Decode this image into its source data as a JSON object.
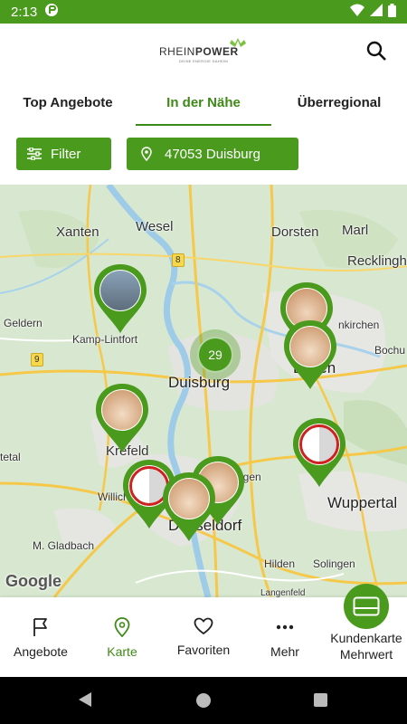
{
  "status_bar": {
    "time": "2:13"
  },
  "header": {
    "brand_light": "RHEIN",
    "brand_bold": "POWER",
    "tagline": "DEINE ENERGIE DAHEIM",
    "search_icon": "search-icon"
  },
  "tabs": [
    {
      "label": "Top Angebote",
      "active": false
    },
    {
      "label": "In der Nähe",
      "active": true
    },
    {
      "label": "Überregional",
      "active": false
    }
  ],
  "filter": {
    "label": "Filter",
    "icon": "sliders-icon"
  },
  "location": {
    "label": "47053 Duisburg",
    "icon": "map-pin-icon"
  },
  "map": {
    "cities": [
      {
        "name": "Wesel"
      },
      {
        "name": "Xanten"
      },
      {
        "name": "Dorsten"
      },
      {
        "name": "Marl"
      },
      {
        "name": "Recklinghau"
      },
      {
        "name": "Geldern"
      },
      {
        "name": "Kamp-Lintfort"
      },
      {
        "name": "Duisburg"
      },
      {
        "name": "nkirchen"
      },
      {
        "name": "Bochu"
      },
      {
        "name": "Essen"
      },
      {
        "name": "Krefeld"
      },
      {
        "name": "tetal"
      },
      {
        "name": "Willich"
      },
      {
        "name": "Düsseldorf"
      },
      {
        "name": "Wuppertal"
      },
      {
        "name": "M. Gladbach"
      },
      {
        "name": "Hilden"
      },
      {
        "name": "Solingen"
      },
      {
        "name": "ngen"
      },
      {
        "name": "Langenfeld"
      }
    ],
    "road_numbers": [
      "8",
      "9"
    ],
    "cluster_count": "29",
    "attribution": "Google"
  },
  "bottom_nav": [
    {
      "label": "Angebote",
      "icon": "flag-icon",
      "active": false
    },
    {
      "label": "Karte",
      "icon": "map-pin-icon",
      "active": true
    },
    {
      "label": "Favoriten",
      "icon": "heart-icon",
      "active": false
    },
    {
      "label": "Mehr",
      "icon": "more-dots-icon",
      "active": false
    }
  ],
  "kundenkarte": {
    "line1": "Kundenkarte",
    "line2": "Mehrwert",
    "icon": "card-icon"
  },
  "colors": {
    "primary": "#4a9a1e",
    "active_text": "#3e8a17",
    "map_bg": "#dfe9d9"
  }
}
